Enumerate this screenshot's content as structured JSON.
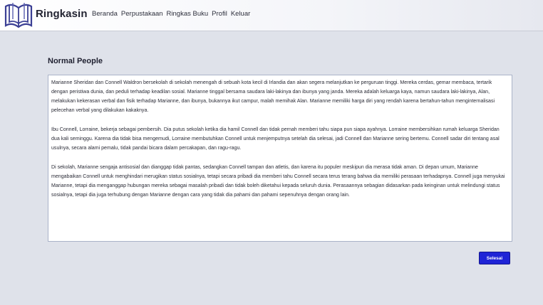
{
  "app": {
    "brand": "Ringkasin",
    "nav": [
      "Beranda",
      "Perpustakaan",
      "Ringkas Buku",
      "Profil",
      "Keluar"
    ]
  },
  "book": {
    "title": "Normal People",
    "paragraphs": [
      "Marianne Sheridan dan Connell Waldron bersekolah di sekolah menengah di sebuah kota kecil di Irlandia dan akan segera melanjutkan ke perguruan tinggi. Mereka cerdas, gemar membaca, tertarik dengan peristiwa dunia, dan peduli terhadap keadilan sosial. Marianne tinggal bersama saudara laki-lakinya dan ibunya yang janda. Mereka adalah keluarga kaya, namun saudara laki-lakinya, Alan, melakukan kekerasan verbal dan fisik terhadap Marianne, dan ibunya, bukannya ikut campur, malah memihak Alan. Marianne memiliki harga diri yang rendah karena bertahun-tahun menginternalisasi pelecehan verbal yang dilakukan kakaknya.",
      "Ibu Connell, Lorraine, bekerja sebagai pembersih. Dia putus sekolah ketika dia hamil Connell dan tidak pernah memberi tahu siapa pun siapa ayahnya. Lorraine membersihkan rumah keluarga Sheridan dua kali seminggu. Karena dia tidak bisa mengemudi, Lorraine membutuhkan Connell untuk menjemputnya setelah dia selesai, jadi Connell dan Marianne sering bertemu. Connell sadar diri tentang asal usulnya, secara alami pemalu, tidak pandai bicara dalam percakapan, dan ragu-ragu.",
      "Di sekolah, Marianne sengaja antisosial dan dianggap tidak pantas, sedangkan Connell tampan dan atletis, dan karena itu populer meskipun dia merasa tidak aman. Di depan umum, Marianne mengabaikan Connell untuk menghindari merugikan status sosialnya, tetapi secara pribadi dia memberi tahu Connell secara terus terang bahwa dia memiliki perasaan terhadapnya. Connell juga menyukai Marianne, tetapi dia menganggap hubungan mereka sebagai masalah pribadi dan tidak boleh diketahui kepada seluruh dunia. Perasaannya sebagian didasarkan pada keinginan untuk melindungi status sosialnya, tetapi dia juga terhubung dengan Marianne dengan cara yang tidak dia pahami dan pahami sepenuhnya dengan orang lain."
    ]
  },
  "actions": {
    "done_label": "Selesai"
  },
  "icons": {
    "logo": "book-logo-icon"
  },
  "colors": {
    "accent": "#1f24d6",
    "logo": "#3b3f94",
    "background": "#dfe2ea"
  }
}
